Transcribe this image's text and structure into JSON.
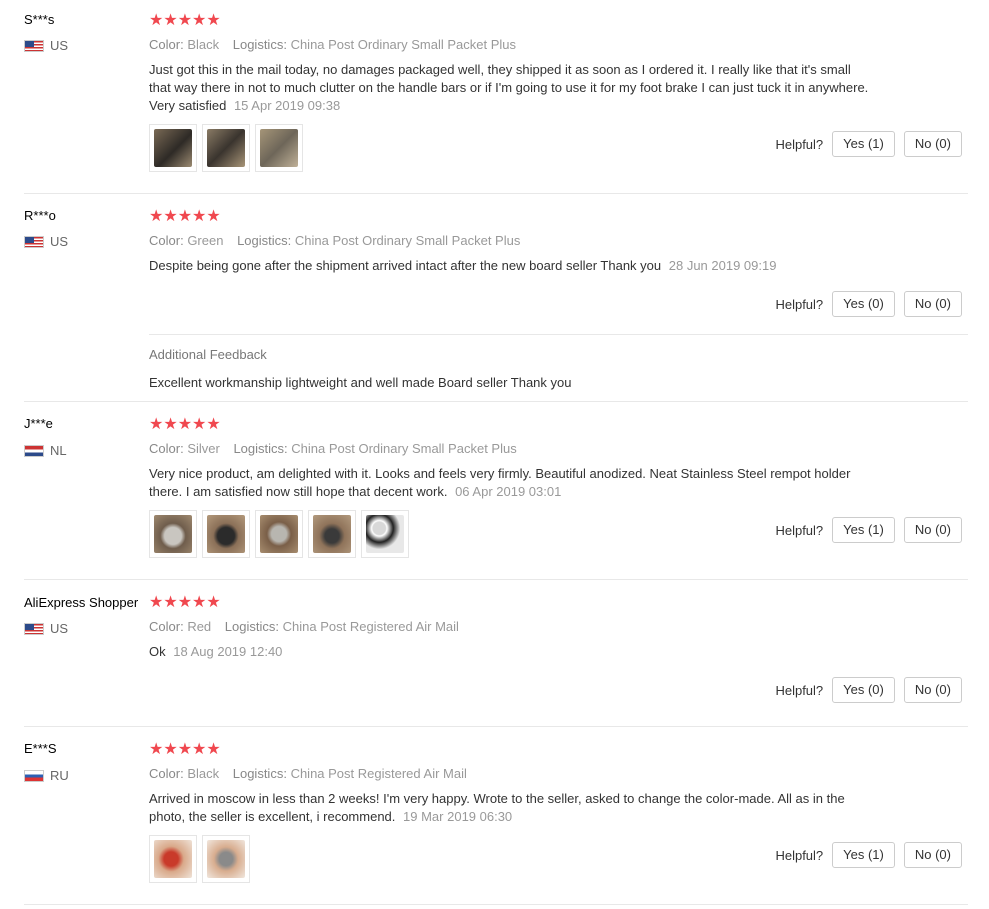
{
  "labels": {
    "color": "Color:",
    "logistics": "Logistics:",
    "helpful": "Helpful?",
    "stars": "★★★★★",
    "additional_feedback": "Additional Feedback"
  },
  "colors": {
    "star": "#f0484f",
    "divider": "#e8e8e8"
  },
  "reviews": [
    {
      "user": "S***s",
      "country": "US",
      "flag_icon": "us-flag-icon",
      "rating": 5,
      "color": "Black",
      "logistics": "China Post Ordinary Small Packet Plus",
      "text": "Just got this in the mail today, no damages packaged well, they shipped it as soon as I ordered it. I really like that it's small that way there in not to much clutter on the handle bars or if I'm going to use it for my foot brake I can just tuck it in anywhere. Very satisfied",
      "date": "15 Apr 2019 09:38",
      "yes": "Yes (1)",
      "no": "No (0)",
      "photos": 3
    },
    {
      "user": "R***o",
      "country": "US",
      "flag_icon": "us-flag-icon",
      "rating": 5,
      "color": "Green",
      "logistics": "China Post Ordinary Small Packet Plus",
      "text": "Despite being gone after the shipment arrived intact after the new board seller Thank you",
      "date": "28 Jun 2019 09:19",
      "yes": "Yes (0)",
      "no": "No (0)",
      "photos": 0,
      "additional_feedback": "Excellent workmanship lightweight and well made Board seller Thank you"
    },
    {
      "user": "J***e",
      "country": "NL",
      "flag_icon": "nl-flag-icon",
      "rating": 5,
      "color": "Silver",
      "logistics": "China Post Ordinary Small Packet Plus",
      "text": "Very nice product, am delighted with it. Looks and feels very firmly. Beautiful anodized. Neat Stainless Steel rempot holder there. I am satisfied now still hope that decent work.",
      "date": "06 Apr 2019 03:01",
      "yes": "Yes (1)",
      "no": "No (0)",
      "photos": 5
    },
    {
      "user": "AliExpress Shopper",
      "country": "US",
      "flag_icon": "us-flag-icon",
      "rating": 5,
      "color": "Red",
      "logistics": "China Post Registered Air Mail",
      "text": "Ok",
      "date": "18 Aug 2019 12:40",
      "yes": "Yes (0)",
      "no": "No (0)",
      "photos": 0
    },
    {
      "user": "E***S",
      "country": "RU",
      "flag_icon": "ru-flag-icon",
      "rating": 5,
      "color": "Black",
      "logistics": "China Post Registered Air Mail",
      "text": "Arrived in moscow in less than 2 weeks! I'm very happy. Wrote to the seller, asked to change the color-made. All as in the photo, the seller is excellent, i recommend.",
      "date": "19 Mar 2019 06:30",
      "yes": "Yes (1)",
      "no": "No (0)",
      "photos": 2
    }
  ]
}
